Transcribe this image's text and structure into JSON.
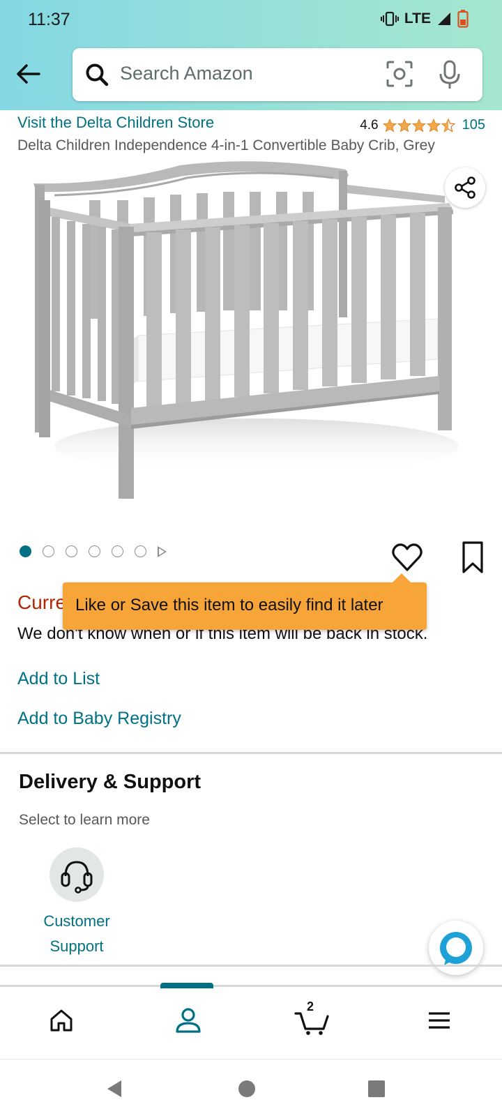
{
  "status_bar": {
    "time": "11:37",
    "network": "LTE"
  },
  "search": {
    "placeholder": "Search Amazon"
  },
  "product": {
    "store_link": "Visit the Delta Children Store",
    "rating": "4.6",
    "rating_count": "105",
    "stars": 4.5,
    "title": "Delta Children Independence 4-in-1 Convertible Baby Crib, Grey",
    "image_count": 6,
    "active_image_index": 0
  },
  "availability": {
    "label": "Currently unavailable.",
    "message": "We don't know when or if this item will be back in stock."
  },
  "tooltip": {
    "text": "Like or Save this item to easily find it later"
  },
  "actions": {
    "add_to_list": "Add to List",
    "add_to_registry": "Add to Baby Registry"
  },
  "delivery_support": {
    "title": "Delivery & Support",
    "subtitle": "Select to learn more",
    "items": [
      {
        "label": "Customer Support",
        "icon": "headset-icon"
      }
    ]
  },
  "bottom_nav": {
    "items": [
      "home-icon",
      "account-icon",
      "cart-icon",
      "menu-icon"
    ],
    "active": "account-icon",
    "cart_count": "2"
  },
  "colors": {
    "link": "#007185",
    "accent": "#f7a539",
    "price_red": "#b12704",
    "star": "#f3a847"
  }
}
